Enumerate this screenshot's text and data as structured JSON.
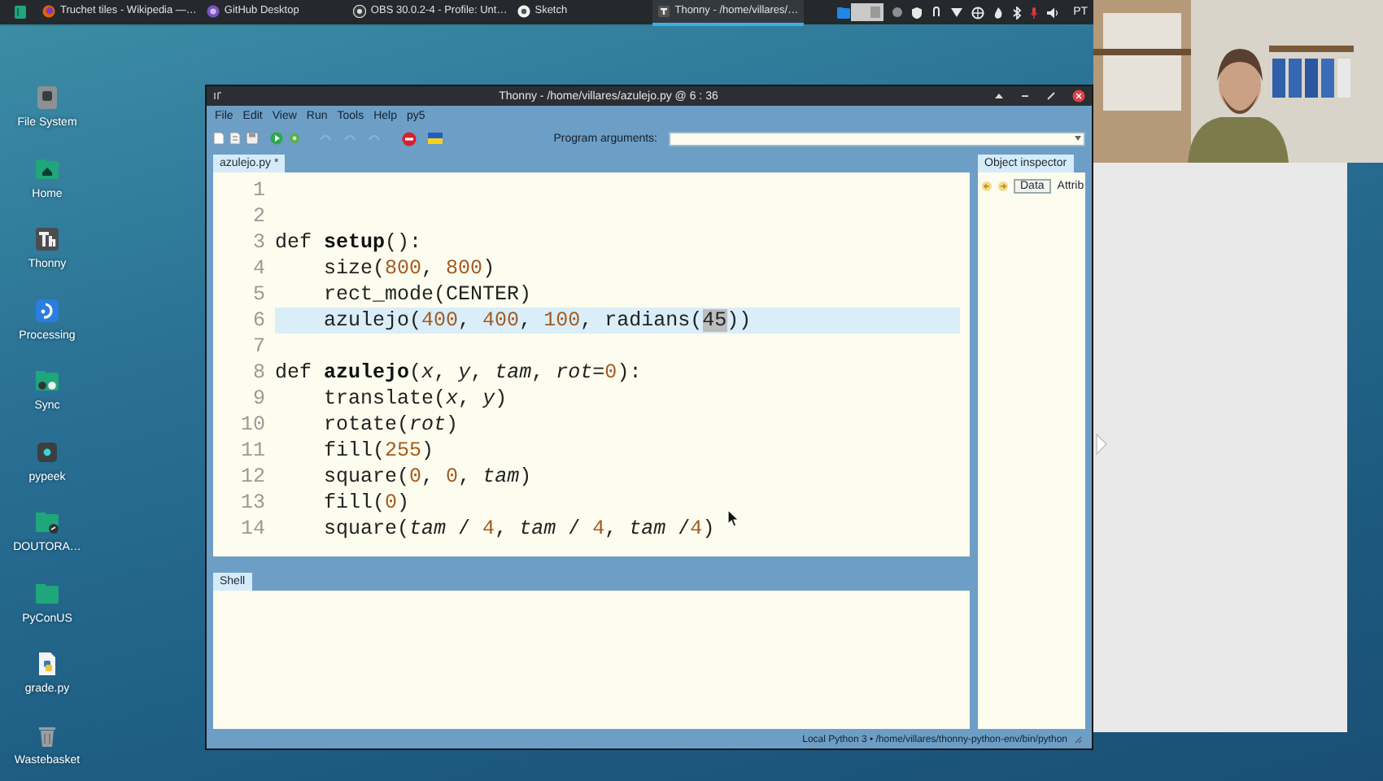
{
  "taskbar": {
    "tasks": [
      {
        "label": "Truchet tiles - Wikipedia —…",
        "kind": "firefox",
        "selected": false
      },
      {
        "label": "GitHub Desktop",
        "kind": "github",
        "selected": false
      },
      {
        "label": "OBS 30.0.2-4 - Profile: Unt…",
        "kind": "obs",
        "selected": false
      },
      {
        "label": "Sketch",
        "kind": "sketch",
        "selected": false
      },
      {
        "label": "Thonny - /home/villares/…",
        "kind": "thonny",
        "selected": true
      }
    ],
    "keyboard_layout": "PT"
  },
  "desktop_icons": [
    {
      "label": "File System",
      "kind": "drive"
    },
    {
      "label": "Home",
      "kind": "home"
    },
    {
      "label": "Thonny",
      "kind": "thonny"
    },
    {
      "label": "Processing",
      "kind": "processing"
    },
    {
      "label": "Sync",
      "kind": "sync"
    },
    {
      "label": "pypeek",
      "kind": "app"
    },
    {
      "label": "DOUTORA…",
      "kind": "folder-link"
    },
    {
      "label": "PyConUS",
      "kind": "folder"
    },
    {
      "label": "grade.py",
      "kind": "python-file"
    },
    {
      "label": "Wastebasket",
      "kind": "trash"
    }
  ],
  "window": {
    "title": "Thonny - /home/villares/azulejo.py @ 6 : 36",
    "menu": [
      "File",
      "Edit",
      "View",
      "Run",
      "Tools",
      "Help",
      "py5"
    ],
    "program_arguments": {
      "label": "Program arguments:"
    },
    "editor_tab": "azulejo.py *",
    "editor": {
      "lines": [
        {
          "number": "1",
          "current": false
        },
        {
          "number": "2",
          "current": false
        },
        {
          "number": "3",
          "current": false,
          "tokens": [
            {
              "text": "def ",
              "kind": "keyword"
            },
            {
              "text": "setup",
              "kind": "defname"
            },
            {
              "text": "():",
              "kind": "plain"
            }
          ]
        },
        {
          "number": "4",
          "current": false,
          "tokens": [
            {
              "text": "    size(",
              "kind": "plain"
            },
            {
              "text": "800",
              "kind": "number"
            },
            {
              "text": ", ",
              "kind": "plain"
            },
            {
              "text": "800",
              "kind": "number"
            },
            {
              "text": ")",
              "kind": "plain"
            }
          ]
        },
        {
          "number": "5",
          "current": false,
          "tokens": [
            {
              "text": "    rect_mode(CENTER)",
              "kind": "plain"
            }
          ]
        },
        {
          "number": "6",
          "current": true,
          "tokens": [
            {
              "text": "    azulejo(",
              "kind": "plain"
            },
            {
              "text": "400",
              "kind": "number"
            },
            {
              "text": ", ",
              "kind": "plain"
            },
            {
              "text": "400",
              "kind": "number"
            },
            {
              "text": ", ",
              "kind": "plain"
            },
            {
              "text": "100",
              "kind": "number"
            },
            {
              "text": ", radians(",
              "kind": "plain"
            },
            {
              "text": "45",
              "kind": "selection"
            },
            {
              "text": "))",
              "kind": "plain"
            }
          ]
        },
        {
          "number": "7",
          "current": false
        },
        {
          "number": "8",
          "current": false,
          "tokens": [
            {
              "text": "def ",
              "kind": "keyword"
            },
            {
              "text": "azulejo",
              "kind": "defname"
            },
            {
              "text": "(",
              "kind": "plain"
            },
            {
              "text": "x",
              "kind": "param"
            },
            {
              "text": ", ",
              "kind": "plain"
            },
            {
              "text": "y",
              "kind": "param"
            },
            {
              "text": ", ",
              "kind": "plain"
            },
            {
              "text": "tam",
              "kind": "param"
            },
            {
              "text": ", ",
              "kind": "plain"
            },
            {
              "text": "rot",
              "kind": "param"
            },
            {
              "text": "=",
              "kind": "plain"
            },
            {
              "text": "0",
              "kind": "number"
            },
            {
              "text": "):",
              "kind": "plain"
            }
          ]
        },
        {
          "number": "9",
          "current": false,
          "tokens": [
            {
              "text": "    translate(",
              "kind": "plain"
            },
            {
              "text": "x",
              "kind": "param"
            },
            {
              "text": ", ",
              "kind": "plain"
            },
            {
              "text": "y",
              "kind": "param"
            },
            {
              "text": ")",
              "kind": "plain"
            }
          ]
        },
        {
          "number": "10",
          "current": false,
          "tokens": [
            {
              "text": "    rotate(",
              "kind": "plain"
            },
            {
              "text": "rot",
              "kind": "param"
            },
            {
              "text": ")",
              "kind": "plain"
            }
          ]
        },
        {
          "number": "11",
          "current": false,
          "tokens": [
            {
              "text": "    fill(",
              "kind": "plain"
            },
            {
              "text": "255",
              "kind": "number"
            },
            {
              "text": ")",
              "kind": "plain"
            }
          ]
        },
        {
          "number": "12",
          "current": false,
          "tokens": [
            {
              "text": "    square(",
              "kind": "plain"
            },
            {
              "text": "0",
              "kind": "number"
            },
            {
              "text": ", ",
              "kind": "plain"
            },
            {
              "text": "0",
              "kind": "number"
            },
            {
              "text": ", ",
              "kind": "plain"
            },
            {
              "text": "tam",
              "kind": "param"
            },
            {
              "text": ")",
              "kind": "plain"
            }
          ]
        },
        {
          "number": "13",
          "current": false,
          "tokens": [
            {
              "text": "    fill(",
              "kind": "plain"
            },
            {
              "text": "0",
              "kind": "number"
            },
            {
              "text": ")",
              "kind": "plain"
            }
          ]
        },
        {
          "number": "14",
          "current": false,
          "tokens": [
            {
              "text": "    square(",
              "kind": "plain"
            },
            {
              "text": "tam",
              "kind": "param"
            },
            {
              "text": " / ",
              "kind": "plain"
            },
            {
              "text": "4",
              "kind": "number"
            },
            {
              "text": ", ",
              "kind": "plain"
            },
            {
              "text": "tam",
              "kind": "param"
            },
            {
              "text": " / ",
              "kind": "plain"
            },
            {
              "text": "4",
              "kind": "number"
            },
            {
              "text": ", ",
              "kind": "plain"
            },
            {
              "text": "tam",
              "kind": "param"
            },
            {
              "text": " /",
              "kind": "plain"
            },
            {
              "text": "4",
              "kind": "number"
            },
            {
              "text": ")",
              "kind": "plain"
            }
          ]
        }
      ]
    },
    "shell_tab": "Shell",
    "object_inspector": {
      "title": "Object inspector",
      "tabs": [
        {
          "label": "Data",
          "selected": true
        },
        {
          "label": "Attrib",
          "selected": false
        }
      ]
    },
    "status_bar": "Local Python 3 • /home/villares/thonny-python-env/bin/python"
  }
}
